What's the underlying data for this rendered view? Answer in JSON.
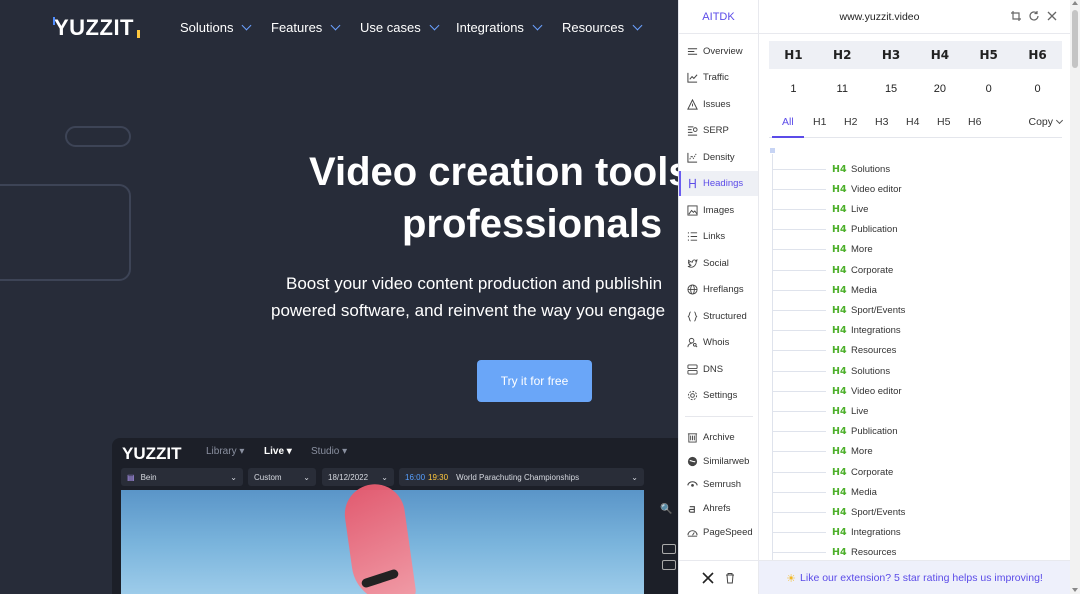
{
  "site": {
    "logo": "YUZZIT",
    "nav": [
      "Solutions",
      "Features",
      "Use cases",
      "Integrations",
      "Resources"
    ],
    "hero_title_line1": "Video creation tools",
    "hero_title_line2": "professionals",
    "hero_sub_line1": "Boost your video content production and publishin",
    "hero_sub_line2": "powered software, and reinvent the way you engage",
    "cta": "Try it for free",
    "app": {
      "brand": "YUZZIT",
      "tabs": [
        "Library",
        "Live",
        "Studio"
      ],
      "channel": "Bein",
      "mode": "Custom",
      "date": "18/12/2022",
      "time_start": "16:00",
      "time_end": "19:30",
      "event": "World Parachuting Championships"
    }
  },
  "extension": {
    "brand": "AITDK",
    "domain": "www.yuzzit.video",
    "sidebar": [
      "Overview",
      "Traffic",
      "Issues",
      "SERP",
      "Density",
      "Headings",
      "Images",
      "Links",
      "Social",
      "Hreflangs",
      "Structured",
      "Whois",
      "DNS",
      "Settings"
    ],
    "sidebar_tools": [
      "Archive",
      "Similarweb",
      "Semrush",
      "Ahrefs",
      "PageSpeed"
    ],
    "active_item": "Headings",
    "heading_counts": {
      "headers": [
        "H1",
        "H2",
        "H3",
        "H4",
        "H5",
        "H6"
      ],
      "values": [
        "1",
        "11",
        "15",
        "20",
        "0",
        "0"
      ]
    },
    "filter_tabs": [
      "All",
      "H1",
      "H2",
      "H3",
      "H4",
      "H5",
      "H6"
    ],
    "active_filter": "All",
    "copy_label": "Copy",
    "tree": [
      {
        "tag": "H4",
        "text": "Solutions"
      },
      {
        "tag": "H4",
        "text": "Video editor"
      },
      {
        "tag": "H4",
        "text": "Live"
      },
      {
        "tag": "H4",
        "text": "Publication"
      },
      {
        "tag": "H4",
        "text": "More"
      },
      {
        "tag": "H4",
        "text": "Corporate"
      },
      {
        "tag": "H4",
        "text": "Media"
      },
      {
        "tag": "H4",
        "text": "Sport/Events"
      },
      {
        "tag": "H4",
        "text": "Integrations"
      },
      {
        "tag": "H4",
        "text": "Resources"
      },
      {
        "tag": "H4",
        "text": "Solutions"
      },
      {
        "tag": "H4",
        "text": "Video editor"
      },
      {
        "tag": "H4",
        "text": "Live"
      },
      {
        "tag": "H4",
        "text": "Publication"
      },
      {
        "tag": "H4",
        "text": "More"
      },
      {
        "tag": "H4",
        "text": "Corporate"
      },
      {
        "tag": "H4",
        "text": "Media"
      },
      {
        "tag": "H4",
        "text": "Sport/Events"
      },
      {
        "tag": "H4",
        "text": "Integrations"
      },
      {
        "tag": "H4",
        "text": "Resources"
      }
    ],
    "footer_banner": "Like our extension? 5 star rating helps us improving!"
  },
  "colors": {
    "accent": "#5b4be8",
    "heading_tag": "#4caf2a",
    "site_bg": "#272c39",
    "cta": "#6aa6f8"
  }
}
